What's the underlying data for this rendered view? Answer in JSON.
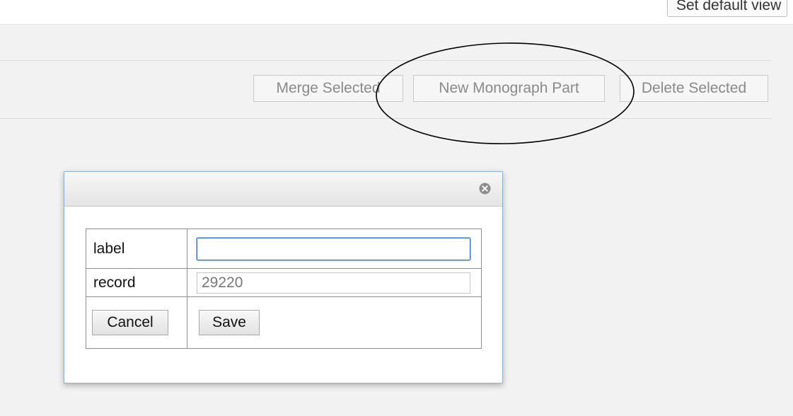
{
  "header": {
    "default_view_label": "Set default view"
  },
  "toolbar": {
    "merge_label": "Merge Selected",
    "new_part_label": "New Monograph Part",
    "delete_label": "Delete Selected"
  },
  "dialog": {
    "close_icon": "close-circle-icon",
    "fields": {
      "label": {
        "name": "label",
        "value": ""
      },
      "record": {
        "name": "record",
        "value": "29220"
      }
    },
    "cancel_label": "Cancel",
    "save_label": "Save"
  },
  "colors": {
    "accent_focus": "#2f6fc9",
    "dialog_border": "#8fb3d6",
    "annotation": "#000000"
  }
}
